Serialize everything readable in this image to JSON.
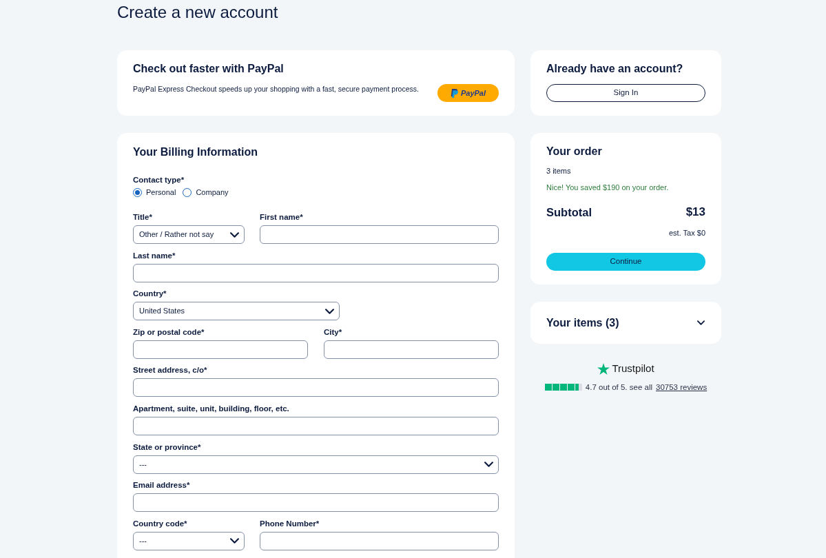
{
  "page": {
    "title": "Create a new account"
  },
  "paypal": {
    "heading": "Check out faster with PayPal",
    "text": "PayPal Express Checkout speeds up your shopping with a fast, secure payment process.",
    "button": "PayPal"
  },
  "billing": {
    "heading": "Your Billing Information",
    "contact_type": {
      "label": "Contact type*",
      "options": [
        {
          "label": "Personal",
          "selected": true
        },
        {
          "label": "Company",
          "selected": false
        }
      ]
    },
    "rows": [
      [
        {
          "kind": "select",
          "label": "Title*",
          "value": "Other / Rather not say"
        },
        {
          "kind": "text",
          "label": "First name*"
        }
      ],
      [
        {
          "kind": "text",
          "label": "Last name*"
        }
      ],
      [
        {
          "kind": "select",
          "label": "Country*",
          "value": "United States"
        }
      ],
      [
        {
          "kind": "text",
          "label": "Zip or postal code*"
        },
        {
          "kind": "text",
          "label": "City*"
        }
      ],
      [
        {
          "kind": "text",
          "label": "Street address, c/o*"
        }
      ],
      [
        {
          "kind": "text",
          "label": "Apartment, suite, unit, building, floor, etc."
        }
      ],
      [
        {
          "kind": "select",
          "label": "State or province*",
          "value": "---"
        }
      ],
      [
        {
          "kind": "text",
          "label": "Email address*"
        }
      ],
      [
        {
          "kind": "select",
          "label": "Country code*",
          "value": "---"
        },
        {
          "kind": "text",
          "label": "Phone Number*"
        }
      ]
    ]
  },
  "account": {
    "heading": "Already have an account?",
    "button": "Sign In"
  },
  "order": {
    "heading": "Your order",
    "item_count": "3 items",
    "savings": "Nice! You saved $190 on your order.",
    "subtotal_label": "Subtotal",
    "subtotal": "$13",
    "tax": "est. Tax $0",
    "button": "Continue"
  },
  "items": {
    "heading": "Your items (3)",
    "expanded": false
  },
  "trustpilot": {
    "name": "Trustpilot",
    "stars": 4.5,
    "rating": "4.7 out of 5. see all",
    "link": "30753 reviews"
  }
}
